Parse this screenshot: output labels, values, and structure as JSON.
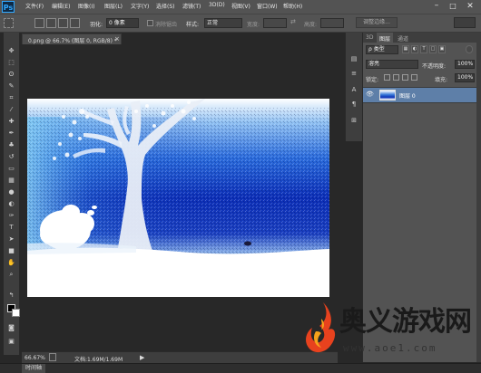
{
  "app": {
    "logo": "Ps"
  },
  "menu": [
    "文件(F)",
    "编辑(E)",
    "图像(I)",
    "图层(L)",
    "文字(Y)",
    "选择(S)",
    "滤镜(T)",
    "3D(D)",
    "视图(V)",
    "窗口(W)",
    "帮助(H)"
  ],
  "window_controls": {
    "minimize": "–",
    "maximize": "□",
    "close": "✕"
  },
  "options": {
    "feather_label": "羽化:",
    "feather_value": "0 像素",
    "antialias_label": "消除锯齿",
    "style_label": "样式:",
    "style_value": "正常",
    "width_label": "宽度:",
    "height_label": "高度:",
    "refine_edge": "调整边缘..."
  },
  "document": {
    "tab_title": "0.png @ 66.7% (图层 0, RGB/8) *",
    "close": "×"
  },
  "status": {
    "zoom": "66.67%",
    "doc_info": "文档:1.69M/1.69M",
    "arrow": "▶"
  },
  "timeline": {
    "label": "时间轴"
  },
  "panels": {
    "tabs": [
      "3D",
      "图层",
      "通道"
    ],
    "kind_label": "ρ 类型",
    "blend_mode": "溶亮",
    "opacity_label": "不透明度:",
    "opacity_value": "100%",
    "lock_label": "锁定:",
    "fill_label": "填充:",
    "fill_value": "100%",
    "layer_name": "图层 0"
  },
  "watermark": {
    "title": "奥义游戏网",
    "url": "www.aoe1.com"
  },
  "colors": {
    "foreground": "#000000",
    "background": "#ffffff",
    "layer_selected": "#5e7fa8"
  }
}
